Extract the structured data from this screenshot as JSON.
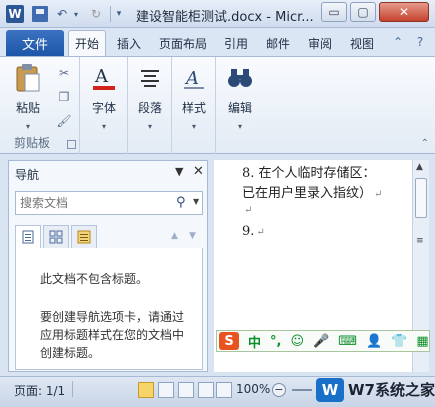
{
  "titlebar": {
    "app_letter": "W",
    "document_title": "建设智能柜测试.docx - Micr...",
    "min": "▭",
    "max": "▢",
    "close": "✕"
  },
  "tabs": {
    "file": "文件",
    "items": [
      "开始",
      "插入",
      "页面布局",
      "引用",
      "邮件",
      "审阅",
      "视图"
    ]
  },
  "ribbon": {
    "paste": "粘贴",
    "font": "字体",
    "paragraph": "段落",
    "styles": "样式",
    "editing": "编辑",
    "clipboard_group": "剪贴板"
  },
  "nav": {
    "title": "导航",
    "search_placeholder": "搜索文档",
    "message_1": "此文档不包含标题。",
    "message_2": "要创建导航选项卡，请通过应用标题样式在您的文档中创建标题。"
  },
  "document": {
    "line_1": "8. 在个人临时存储区：",
    "line_2": "已在用户里录入指纹）",
    "line_3": "",
    "line_4": "9."
  },
  "ime": {
    "logo": "S",
    "items": [
      "中",
      "°,",
      "☺",
      "🎤",
      "⌨",
      "👤",
      "👕",
      "▦"
    ]
  },
  "statusbar": {
    "page": "页面: 1/1",
    "zoom": "100%"
  },
  "watermark": {
    "logo": "W",
    "text": "W7系统之家"
  },
  "colors": {
    "accent": "#1e56a8",
    "ribbon_bg": "#e3ebf5",
    "ime_green": "#0b8f2c"
  }
}
